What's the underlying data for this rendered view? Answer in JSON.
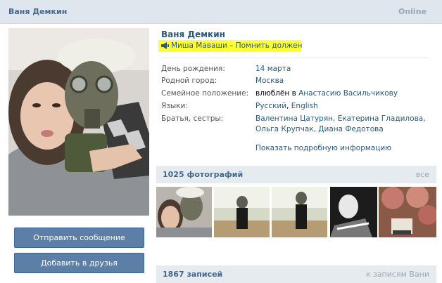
{
  "header": {
    "name": "Ваня Демкин",
    "online": "Online"
  },
  "profile": {
    "name": "Ваня Демкин",
    "status": "Миша Маваши – Помнить должен",
    "fields": [
      {
        "label": "День рождения:",
        "value": "14 марта"
      },
      {
        "label": "Родной город:",
        "value": "Москва"
      },
      {
        "label": "Семейное положение:",
        "value_plain": "влюблён в",
        "value_link": "Анастасию Васильчикову"
      },
      {
        "label": "Языки:",
        "value_a": "Русский",
        "value_sep": ", ",
        "value_b": "English"
      },
      {
        "label": "Братья, сестры:",
        "value": "Валентина Цатурян, Екатерина Гладилова,",
        "value2": "Ольга Крупчак, Диана Федотова"
      }
    ],
    "more_link": "Показать подробную информацию"
  },
  "buttons": {
    "message": "Отправить сообщение",
    "add_friend": "Добавить в друзья"
  },
  "photos": {
    "title": "1025 фотографий",
    "all": "все"
  },
  "wall": {
    "title": "1867 записей",
    "link": "к записям Вани"
  },
  "colors": {
    "link": "#2b587a",
    "header": "#45688e",
    "status_highlight": "#ffff33",
    "button": "#5b7fa6"
  }
}
